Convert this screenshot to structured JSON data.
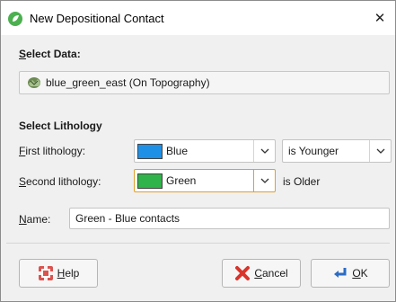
{
  "window": {
    "title": "New Depositional Contact",
    "close_label": "✕"
  },
  "select_data": {
    "heading_prefix": "S",
    "heading_rest": "elect Data:",
    "value": "blue_green_east (On Topography)"
  },
  "select_lithology": {
    "heading": "Select Lithology",
    "first": {
      "label_prefix": "F",
      "label_rest": "irst lithology:",
      "value": "Blue",
      "swatch_color": "#1e90e6",
      "relation": "is Younger"
    },
    "second": {
      "label_prefix": "S",
      "label_rest": "econd lithology:",
      "value": "Green",
      "swatch_color": "#2fb34a",
      "relation": "is Older"
    }
  },
  "name_field": {
    "label_prefix": "N",
    "label_rest": "ame:",
    "value": "Green - Blue contacts"
  },
  "buttons": {
    "help": {
      "label_prefix": "H",
      "label_rest": "elp",
      "icon": "lifebuoy-icon"
    },
    "cancel": {
      "label_prefix": "C",
      "label_rest": "ancel",
      "icon": "cancel-x-icon"
    },
    "ok": {
      "label_prefix": "O",
      "label_rest": "K",
      "icon": "return-arrow-icon"
    }
  },
  "colors": {
    "accent_focus": "#e0a02b",
    "titlebar_bg": "#ffffff",
    "dialog_bg": "#f0f0f0"
  }
}
